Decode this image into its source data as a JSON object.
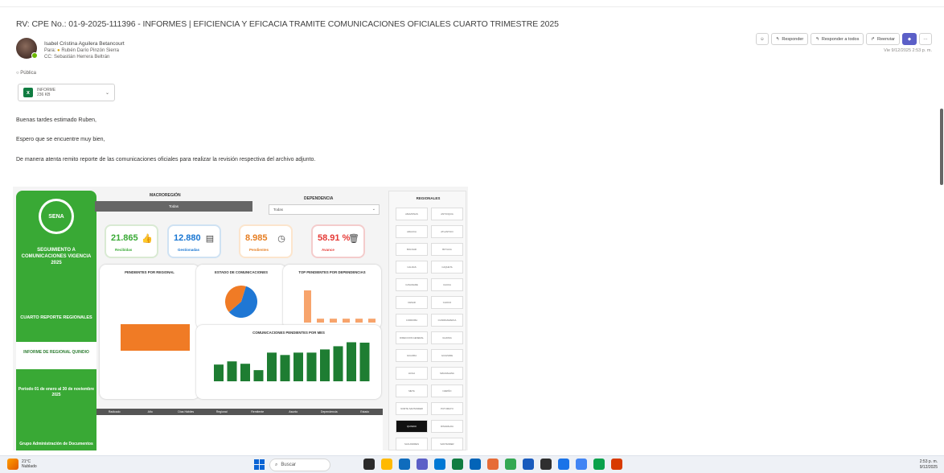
{
  "email": {
    "subject": "RV: CPE No.: 01-9-2025-111396 - INFORMES | EFICIENCIA Y EFICACIA TRAMITE COMUNICACIONES OFICIALES CUARTO TRIMESTRE 2025",
    "from": "Isabel Cristina Aguilera Betancourt",
    "to_label": "Para:",
    "to": "Rubén Darío Pinzón Sierra",
    "cc_label": "CC:",
    "cc": "Sebastián Herrera Beltrán",
    "date": "Vie 9/12/2025 2:53 p. m.",
    "public_label": "Pública",
    "attachment": {
      "name": "INFORME",
      "size": "236 KB"
    },
    "body": [
      "Buenas tardes estimado Ruben,",
      "Espero que se encuentre muy bien,",
      "De manera atenta remito reporte de las comunicaciones oficiales para realizar la revisión respectiva del archivo adjunto."
    ]
  },
  "actions": {
    "reply": "Responder",
    "reply_all": "Responder a todos",
    "forward": "Reenviar"
  },
  "dashboard": {
    "logo_text": "SENA",
    "side_title": "SEGUIMIENTO A COMUNICACIONES VIGENCIA 2025",
    "side_report": "CUARTO REPORTE REGIONALES",
    "side_active": "INFORME DE REGIONAL QUINDIO",
    "side_period": "Periodo 01 de enero al 30 de noviembre 2025",
    "side_footer": "Grupo Administración de Documentos",
    "macro_label": "MACROREGIÓN",
    "macro_value": "Todas",
    "dep_label": "DEPENDENCIA",
    "dep_value": "Todas",
    "kpis": [
      {
        "value": "21.865",
        "label": "Recibidas",
        "icon": "thumbs-up-icon"
      },
      {
        "value": "12.880",
        "label": "Gestionadas",
        "icon": "document-icon"
      },
      {
        "value": "8.985",
        "label": "Pendientes",
        "icon": "clock-icon"
      },
      {
        "value": "58.91 %",
        "label": "Avance",
        "icon": "trash-icon"
      }
    ],
    "panel_titles": {
      "regional": "PENDIENTES POR REGIONAL",
      "estado": "ESTADO DE COMUNICACIONES",
      "top": "TOP PENDIENTES POR DEPENDENCIAS",
      "mes": "COMUNICACIONES PENDIENTES POR MES"
    },
    "table_headers": [
      "Radicado",
      "Año",
      "Días Hábiles",
      "Regional",
      "Remitente",
      "Asunto",
      "Dependencia",
      "Estado"
    ],
    "regionales_title": "REGIONALES",
    "regionales": [
      "AMAZONAS",
      "ANTIOQUIA",
      "ARAUCA",
      "ATLANTICO",
      "BOLIVAR",
      "BOYACA",
      "CALDAS",
      "CAQUETA",
      "CASANARE",
      "CAUCA",
      "CESAR",
      "CHOCO",
      "CORDOBA",
      "CUNDINAMARCA",
      "DIRECCION GENERAL",
      "GUAINIA",
      "GUAJIRA",
      "GUAVIARE",
      "HUILA",
      "MAGDALENA",
      "META",
      "NARIÑO",
      "NORTE SANTANDER",
      "PUTUMAYO",
      "QUINDIO",
      "RISARALDA",
      "SAN ANDRES",
      "SANTANDER"
    ]
  },
  "chart_data": [
    {
      "type": "pie",
      "labels": [
        "Gestionadas",
        "Pendientes"
      ],
      "values": [
        58.91,
        41.09
      ],
      "colors": [
        "#1f77d4",
        "#f07b25"
      ]
    },
    {
      "type": "bar",
      "values": [
        66,
        8,
        8,
        8,
        8,
        8
      ],
      "color": "#f7a46c"
    },
    {
      "type": "bar",
      "values": [
        42,
        50,
        44,
        28,
        72,
        66,
        72,
        72,
        80,
        88,
        98,
        97
      ],
      "ylim": [
        0,
        105
      ],
      "color": "#1e7d32"
    }
  ],
  "taskbar": {
    "weather_temp": "21°C",
    "weather_desc": "Nublado",
    "search_placeholder": "Buscar",
    "time": "2:53 p. m.",
    "date": "9/12/2025"
  }
}
